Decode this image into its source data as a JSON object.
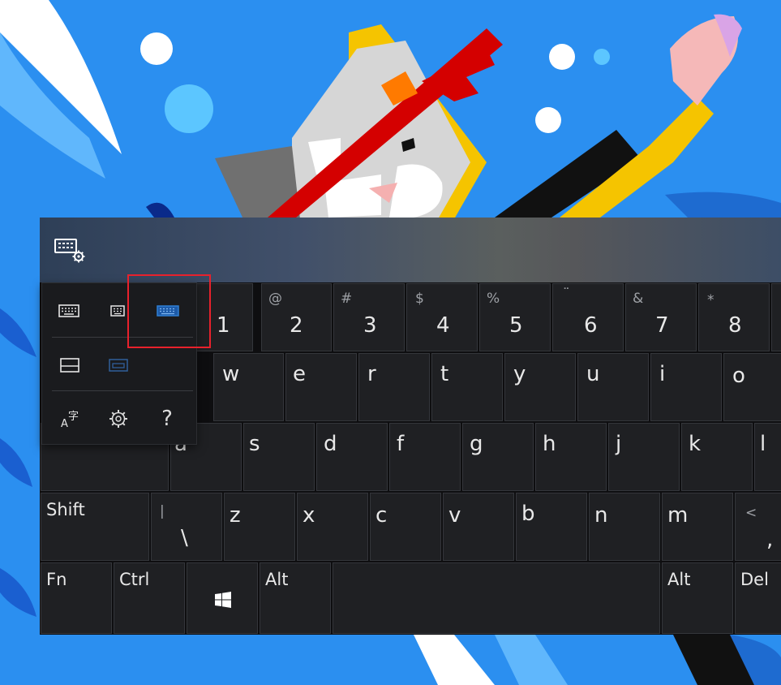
{
  "keyboard": {
    "number_row": [
      {
        "main": "1",
        "shift": "!"
      },
      {
        "main": "2",
        "shift": "@"
      },
      {
        "main": "3",
        "shift": "#"
      },
      {
        "main": "4",
        "shift": "$"
      },
      {
        "main": "5",
        "shift": "%"
      },
      {
        "main": "6",
        "shift": "¨"
      },
      {
        "main": "7",
        "shift": "&"
      },
      {
        "main": "8",
        "shift": "*"
      }
    ],
    "top_row": [
      "w",
      "e",
      "r",
      "t",
      "y",
      "u",
      "i",
      "o"
    ],
    "home_row": [
      "a",
      "s",
      "d",
      "f",
      "g",
      "h",
      "j",
      "k",
      "l"
    ],
    "bottom_row": {
      "shift": "Shift",
      "backslash": {
        "main": "\\",
        "shift": "|"
      },
      "letters": [
        "z",
        "x",
        "c",
        "v",
        "b",
        "n",
        "m"
      ],
      "comma": {
        "main": ",",
        "shift": "<"
      }
    },
    "control_row": {
      "fn": "Fn",
      "ctrl": "Ctrl",
      "alt_left": "Alt",
      "alt_right": "Alt",
      "del": "Del"
    }
  },
  "layout_menu": {
    "language_glyph": "字",
    "language_letter": "A",
    "help_label": "?"
  },
  "colors": {
    "highlight": "#e8212c",
    "selected_layout": "#2f7fd4",
    "wallpaper": "#2b8ff0"
  },
  "icons": {
    "settings_button": "keyboard-settings-icon",
    "layouts": [
      "keyboard-default-icon",
      "keyboard-small-icon",
      "keyboard-wide-icon"
    ],
    "modes": [
      "keyboard-docked-icon",
      "keyboard-undocked-icon"
    ],
    "tools": [
      "language-icon",
      "gear-icon",
      "help-icon"
    ]
  }
}
